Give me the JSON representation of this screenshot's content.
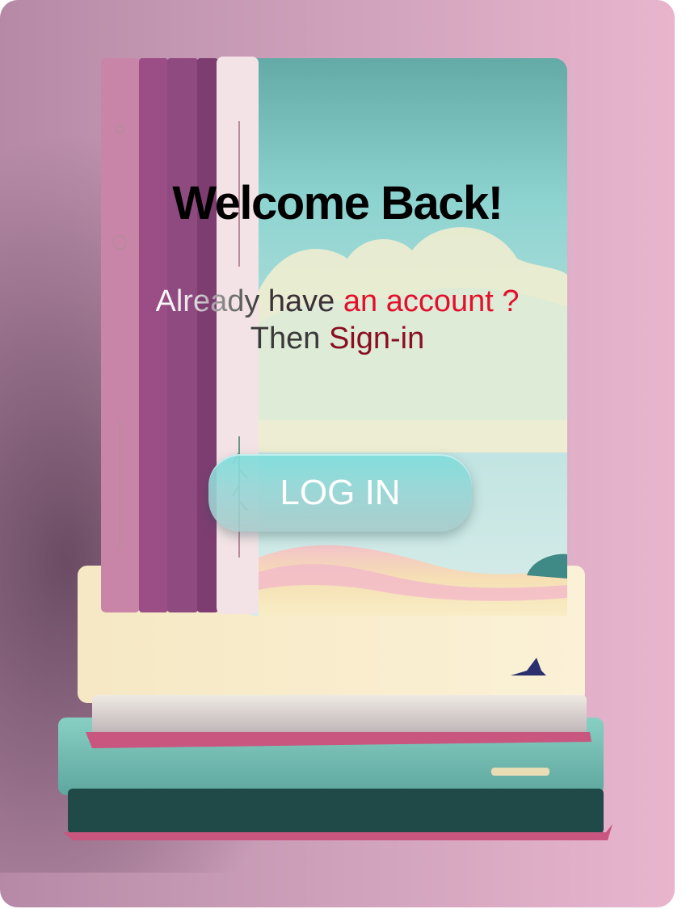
{
  "login": {
    "title": "Welcome Back!",
    "subtitle": {
      "already": "Already",
      "have": " have ",
      "an_account": "an account ?",
      "then": "Then ",
      "sign_in": "Sign-in"
    },
    "button_label": "LOG IN"
  },
  "colors": {
    "background": "#cfa1bb",
    "title": "#000000",
    "account_accent": "#e2102c",
    "signin_accent": "#8a0e22",
    "button": "#96d6d6",
    "button_text": "#ffffff"
  }
}
